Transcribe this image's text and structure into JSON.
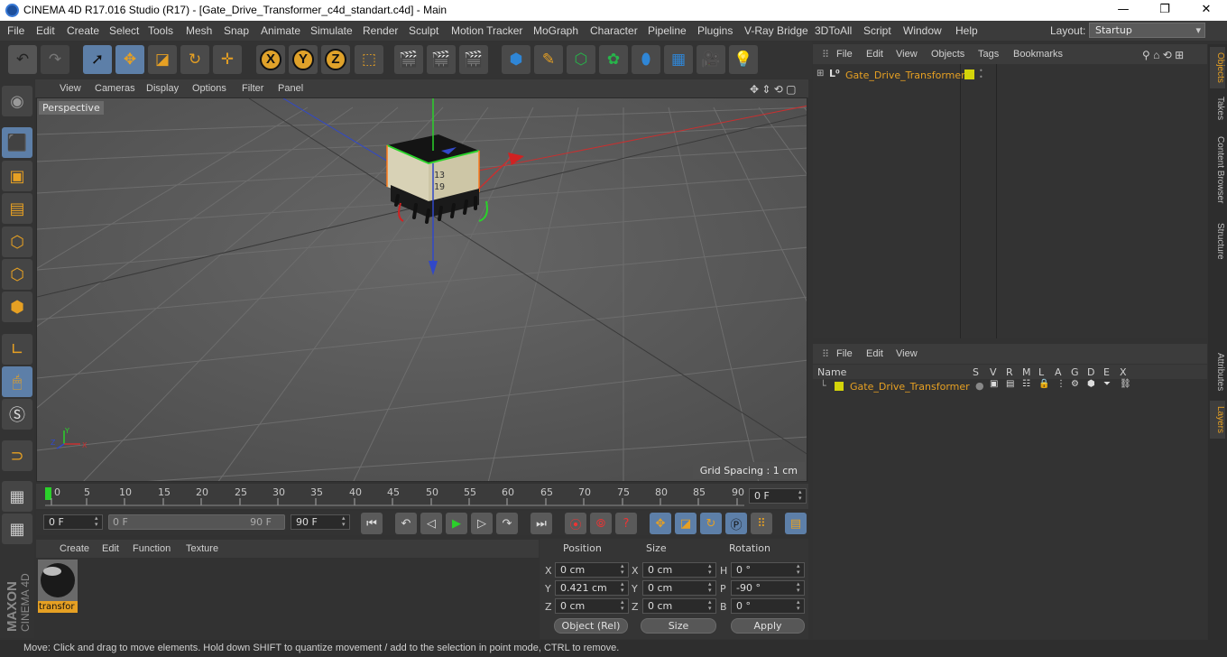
{
  "window": {
    "title": "CINEMA 4D R17.016 Studio (R17) - [Gate_Drive_Transformer_c4d_standart.c4d] - Main",
    "minimize": "—",
    "maximize": "❐",
    "close": "✕"
  },
  "menu": [
    "File",
    "Edit",
    "Create",
    "Select",
    "Tools",
    "Mesh",
    "Snap",
    "Animate",
    "Simulate",
    "Render",
    "Sculpt",
    "Motion Tracker",
    "MoGraph",
    "Character",
    "Pipeline",
    "Plugins",
    "V-Ray Bridge",
    "3DToAll",
    "Script",
    "Window",
    "Help"
  ],
  "layout": {
    "label": "Layout:",
    "value": "Startup"
  },
  "viewport": {
    "menu": [
      "View",
      "Cameras",
      "Display",
      "Options",
      "Filter",
      "Panel"
    ],
    "camera_label": "Perspective",
    "grid_spacing": "Grid Spacing : 1 cm",
    "object_marking_1": "13",
    "object_marking_2": "19",
    "axis_x": "X",
    "axis_y": "Y",
    "axis_z": "Z"
  },
  "timeline": {
    "ticks": [
      "0",
      "5",
      "10",
      "15",
      "20",
      "25",
      "30",
      "35",
      "40",
      "45",
      "50",
      "55",
      "60",
      "65",
      "70",
      "75",
      "80",
      "85",
      "90"
    ],
    "current_frame": "0 F",
    "start_field": "0 F",
    "range_start": "0 F",
    "range_end": "90 F",
    "end_field": "90 F"
  },
  "material_editor": {
    "menu": [
      "Create",
      "Edit",
      "Function",
      "Texture"
    ],
    "material_name": "transfor"
  },
  "coordinates": {
    "headers": {
      "position": "Position",
      "size": "Size",
      "rotation": "Rotation"
    },
    "position": {
      "x_label": "X",
      "x": "0 cm",
      "y_label": "Y",
      "y": "0.421 cm",
      "z_label": "Z",
      "z": "0 cm"
    },
    "size": {
      "x_label": "X",
      "x": "0 cm",
      "y_label": "Y",
      "y": "0 cm",
      "z_label": "Z",
      "z": "0 cm"
    },
    "rotation": {
      "h_label": "H",
      "h": "0 °",
      "p_label": "P",
      "p": "-90 °",
      "b_label": "B",
      "b": "0 °"
    },
    "mode": "Object (Rel)",
    "size_mode": "Size",
    "apply": "Apply"
  },
  "objects_panel": {
    "menu": [
      "File",
      "Edit",
      "View",
      "Objects",
      "Tags",
      "Bookmarks"
    ],
    "object_name": "Gate_Drive_Transformer",
    "accent_color": "#e6a023",
    "layer_color": "#d4d40a"
  },
  "layers_panel": {
    "menu": [
      "File",
      "Edit",
      "View"
    ],
    "header_name": "Name",
    "columns": [
      "S",
      "V",
      "R",
      "M",
      "L",
      "A",
      "G",
      "D",
      "E",
      "X"
    ],
    "layer_name": "Gate_Drive_Transformer"
  },
  "right_tabs": [
    "Objects",
    "Takes",
    "Content Browser",
    "Structure",
    "Attributes",
    "Layers"
  ],
  "status": "Move: Click and drag to move elements. Hold down SHIFT to quantize movement / add to the selection in point mode, CTRL to remove.",
  "brand": {
    "line1": "MAXON",
    "line2": "CINEMA 4D"
  }
}
